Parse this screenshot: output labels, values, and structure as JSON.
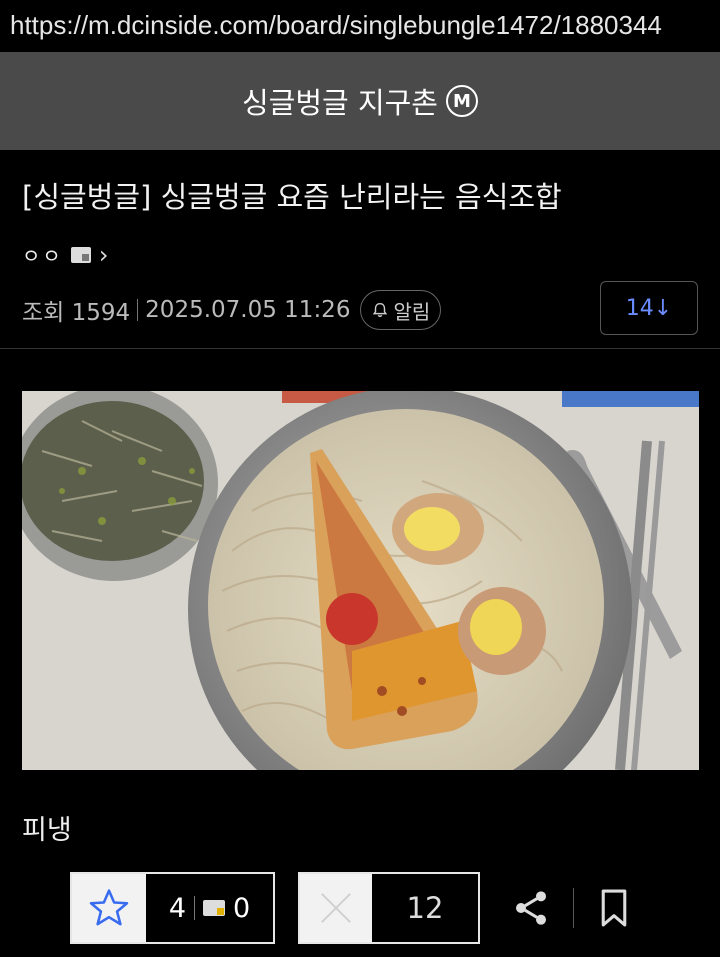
{
  "browser": {
    "url": "https://m.dcinside.com/board/singlebungle1472/1880344"
  },
  "gallery": {
    "title": "싱글벙글 지구촌",
    "badge": "M"
  },
  "post": {
    "title": "[싱글벙글] 싱글벙글 요즘 난리라는 음식조합",
    "author": "ㅇㅇ",
    "views_label": "조회 1594",
    "date": "2025.07.05 11:26",
    "alarm_label": "알림",
    "comment_button": "14↓",
    "body": "피냉",
    "image_icon": "naengmyeon-with-pizza-photo"
  },
  "actions": {
    "recommend_count": "4",
    "fixed_recommend_count": "0",
    "downvote_count": "12",
    "icons": {
      "recommend": "star-icon",
      "downvote": "x-icon",
      "share": "share-icon",
      "bookmark": "bookmark-icon"
    }
  },
  "colors": {
    "header_bg": "#4a4a4a",
    "background": "#000000",
    "comment_count": "#6b8cff",
    "star_outline": "#3a6cf0"
  }
}
